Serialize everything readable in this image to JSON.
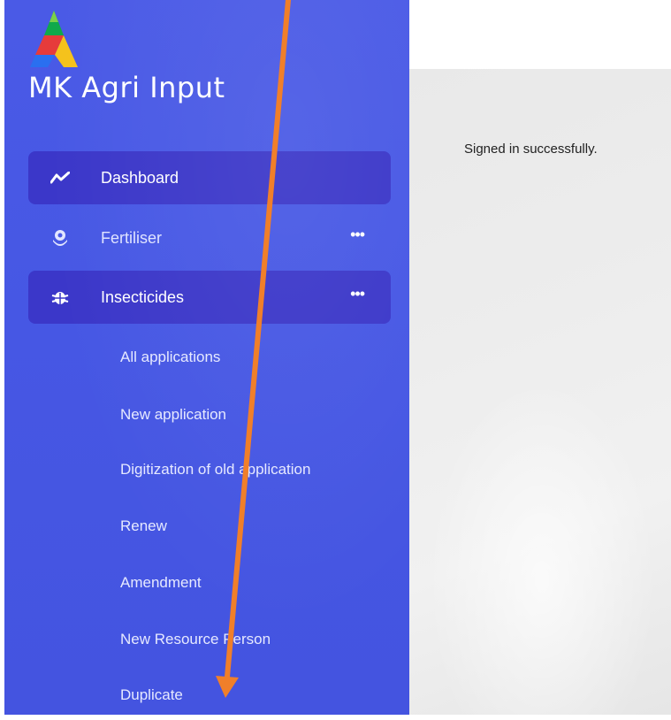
{
  "brand": {
    "title": "MK Agri Input"
  },
  "nav": {
    "dashboard": "Dashboard",
    "fertiliser": "Fertiliser",
    "insecticides": "Insecticides",
    "more": "•••"
  },
  "submenu": [
    "All applications",
    "New application",
    "Digitization of old application",
    "Renew",
    "Amendment",
    "New Resource Person",
    "Duplicate"
  ],
  "flash": {
    "message": "Signed in successfully."
  },
  "colors": {
    "sidebar": "#4a5ae6",
    "active_item": "#3b37c9",
    "annotation_arrow": "#f07f2a"
  },
  "icons": {
    "dashboard": "chart-line-icon",
    "fertiliser": "flower-icon",
    "insecticides": "bug-icon"
  }
}
